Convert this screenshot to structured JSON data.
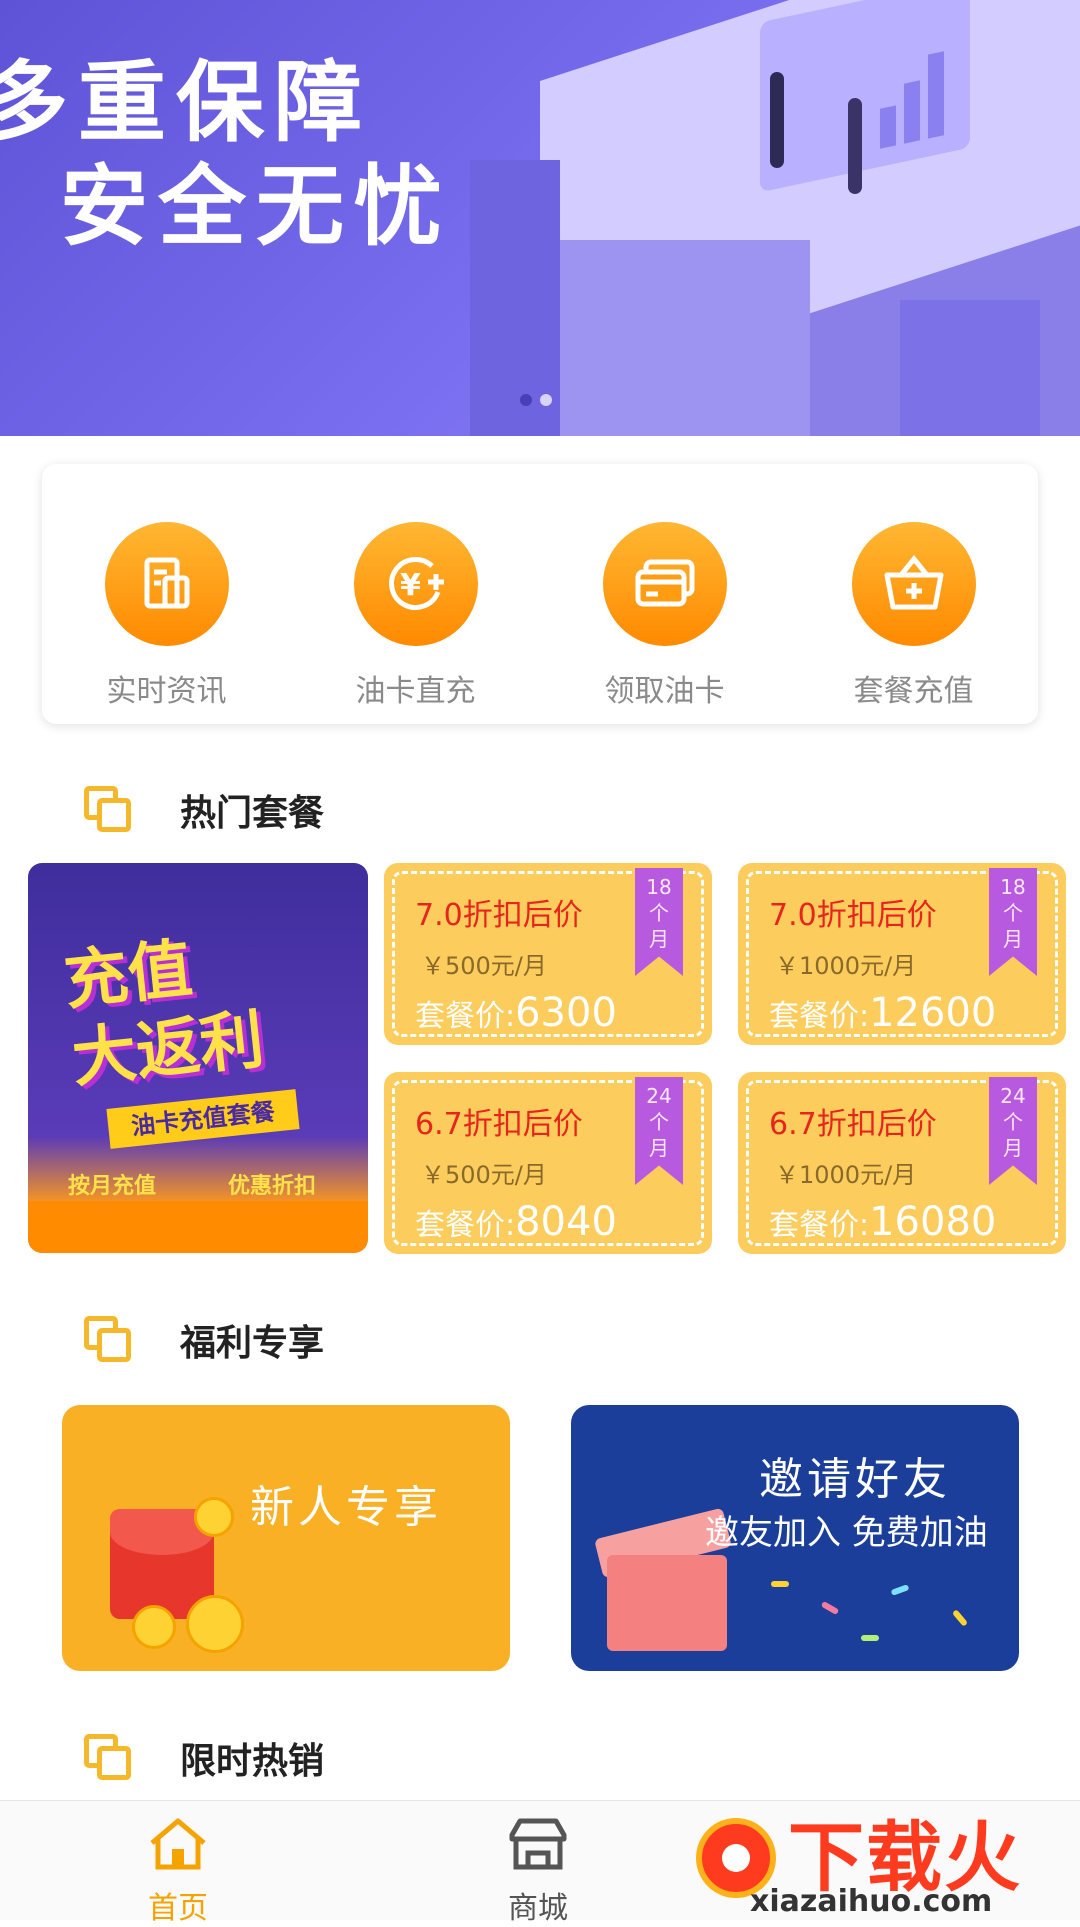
{
  "banner": {
    "line1": "多重保障",
    "line2": "安全无忧",
    "dots": 2,
    "active_dot": 0
  },
  "quick_menu": [
    {
      "label": "实时资讯",
      "icon": "news-icon"
    },
    {
      "label": "油卡直充",
      "icon": "yen-plus-icon"
    },
    {
      "label": "领取油卡",
      "icon": "card-icon"
    },
    {
      "label": "套餐充值",
      "icon": "basket-plus-icon"
    }
  ],
  "sections": {
    "hot": "热门套餐",
    "welfare": "福利专享",
    "flash": "限时热销"
  },
  "promo_poster": {
    "line1": "充值",
    "line2": "大返利",
    "ribbon": "油卡充值套餐",
    "left_tag": "按月充值",
    "right_tag": "优惠折扣"
  },
  "packages": [
    {
      "discount": "7.0折扣后价",
      "monthly": "￥500元/月",
      "price_label": "套餐价:",
      "price": "6300",
      "term": [
        "18",
        "个",
        "月"
      ]
    },
    {
      "discount": "7.0折扣后价",
      "monthly": "￥1000元/月",
      "price_label": "套餐价:",
      "price": "12600",
      "term": [
        "18",
        "个",
        "月"
      ]
    },
    {
      "discount": "6.7折扣后价",
      "monthly": "￥500元/月",
      "price_label": "套餐价:",
      "price": "8040",
      "term": [
        "24",
        "个",
        "月"
      ]
    },
    {
      "discount": "6.7折扣后价",
      "monthly": "￥1000元/月",
      "price_label": "套餐价:",
      "price": "16080",
      "term": [
        "24",
        "个",
        "月"
      ]
    }
  ],
  "welfare": {
    "new_user": "新人专享",
    "invite_title": "邀请好友",
    "invite_sub": "邀友加入 免费加油"
  },
  "tabbar": {
    "home": "首页",
    "mall": "商城"
  },
  "watermark": {
    "text": "下载火",
    "url": "xiazaihuo.com"
  },
  "colors": {
    "accent": "#f5a300",
    "banner": "#6c62e6",
    "package_bg": "#fccc5c",
    "discount_red": "#e8251d",
    "invite_blue": "#1a3e9a"
  }
}
